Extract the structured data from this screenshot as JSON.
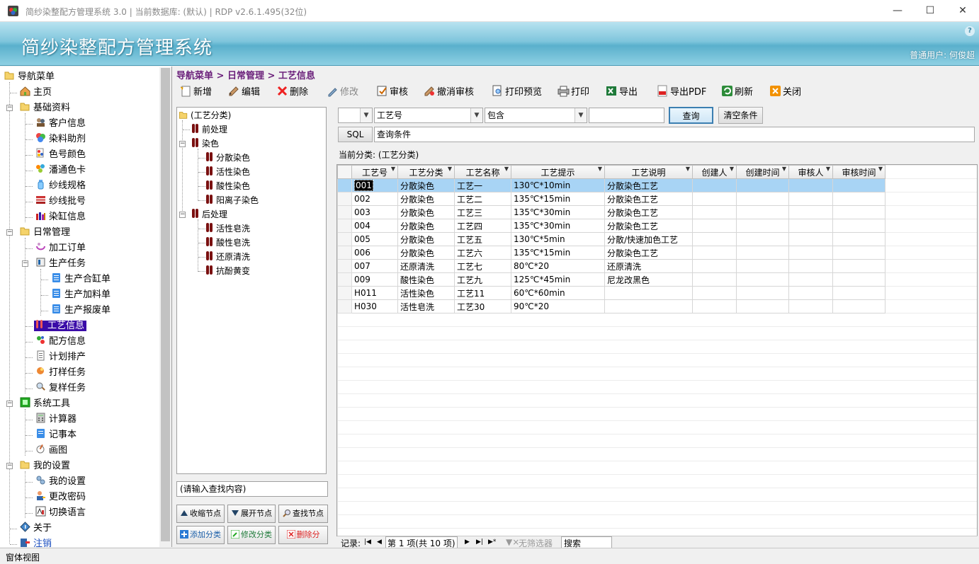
{
  "window": {
    "title": "简纱染整配方管理系统 3.0 | 当前数据库: (默认) | RDP v2.6.1.495(32位)",
    "minimize": "—",
    "maximize": "☐",
    "close": "✕"
  },
  "banner": {
    "title": "简纱染整配方管理系统",
    "user": "普通用户: 何俊超",
    "help": "?"
  },
  "nav": {
    "root": "导航菜单",
    "home": "主页",
    "basic": "基础资料",
    "basic_items": [
      "客户信息",
      "染料助剂",
      "色号颜色",
      "潘通色卡",
      "纱线规格",
      "纱线批号",
      "染缸信息"
    ],
    "daily": "日常管理",
    "order": "加工订单",
    "task": "生产任务",
    "task_items": [
      "生产合缸单",
      "生产加料单",
      "生产报废单"
    ],
    "process": "工艺信息",
    "daily_items2": [
      "配方信息",
      "计划排产",
      "打样任务",
      "复样任务"
    ],
    "tools": "系统工具",
    "tools_items": [
      "计算器",
      "记事本",
      "画图"
    ],
    "mine": "我的设置",
    "mine_items": [
      "我的设置",
      "更改密码",
      "切换语言"
    ],
    "about": "关于",
    "logout": "注销"
  },
  "breadcrumb": "导航菜单 > 日常管理 > 工艺信息",
  "toolbar": {
    "new": "新增",
    "edit": "编辑",
    "delete": "删除",
    "modify": "修改",
    "audit": "审核",
    "unaudit": "撤消审核",
    "preview": "打印预览",
    "print": "打印",
    "export": "导出",
    "pdf": "导出PDF",
    "refresh": "刷新",
    "close": "关闭"
  },
  "category_tree": {
    "root": "(工艺分类)",
    "pre": "前处理",
    "dye": "染色",
    "dye_items": [
      "分散染色",
      "活性染色",
      "酸性染色",
      "阳离子染色"
    ],
    "post": "后处理",
    "post_items": [
      "活性皂洗",
      "酸性皂洗",
      "还原清洗",
      "抗酚黄变"
    ]
  },
  "tree_search": {
    "placeholder": "(请输入查找内容)"
  },
  "tree_buttons": {
    "collapse": "收缩节点",
    "expand": "展开节点",
    "find": "查找节点",
    "add": "添加分类",
    "modify": "修改分类",
    "delete": "删除分"
  },
  "query": {
    "field": "工艺号",
    "op": "包含",
    "value": "",
    "search": "查询",
    "clear": "清空条件",
    "sql": "SQL",
    "sql_text": "查询条件"
  },
  "current_category": "当前分类: (工艺分类)",
  "grid": {
    "columns": [
      "工艺号",
      "工艺分类",
      "工艺名称",
      "工艺提示",
      "工艺说明",
      "创建人",
      "创建时间",
      "审核人",
      "审核时间"
    ],
    "rows": [
      [
        "001",
        "分散染色",
        "工艺一",
        "130℃*10min",
        "分散染色工艺",
        "",
        "",
        "",
        ""
      ],
      [
        "002",
        "分散染色",
        "工艺二",
        "135℃*15min",
        "分散染色工艺",
        "",
        "",
        "",
        ""
      ],
      [
        "003",
        "分散染色",
        "工艺三",
        "135℃*30min",
        "分散染色工艺",
        "",
        "",
        "",
        ""
      ],
      [
        "004",
        "分散染色",
        "工艺四",
        "135℃*30min",
        "分散染色工艺",
        "",
        "",
        "",
        ""
      ],
      [
        "005",
        "分散染色",
        "工艺五",
        "130℃*5min",
        "分散/快速加色工艺",
        "",
        "",
        "",
        ""
      ],
      [
        "006",
        "分散染色",
        "工艺六",
        "135℃*15min",
        "分散染色工艺",
        "",
        "",
        "",
        ""
      ],
      [
        "007",
        "还原清洗",
        "工艺七",
        "80℃*20",
        "还原清洗",
        "",
        "",
        "",
        ""
      ],
      [
        "009",
        "酸性染色",
        "工艺九",
        "125℃*45min",
        "尼龙改黑色",
        "",
        "",
        "",
        ""
      ],
      [
        "H011",
        "活性染色",
        "工艺11",
        "60℃*60min",
        "",
        "",
        "",
        "",
        ""
      ],
      [
        "H030",
        "活性皂洗",
        "工艺30",
        "90℃*20",
        "",
        "",
        "",
        "",
        ""
      ]
    ]
  },
  "navigator": {
    "label": "记录:",
    "page": "第 1 项(共 10 项)",
    "filter": "无筛选器",
    "search": "搜索"
  },
  "status": "窗体视图"
}
